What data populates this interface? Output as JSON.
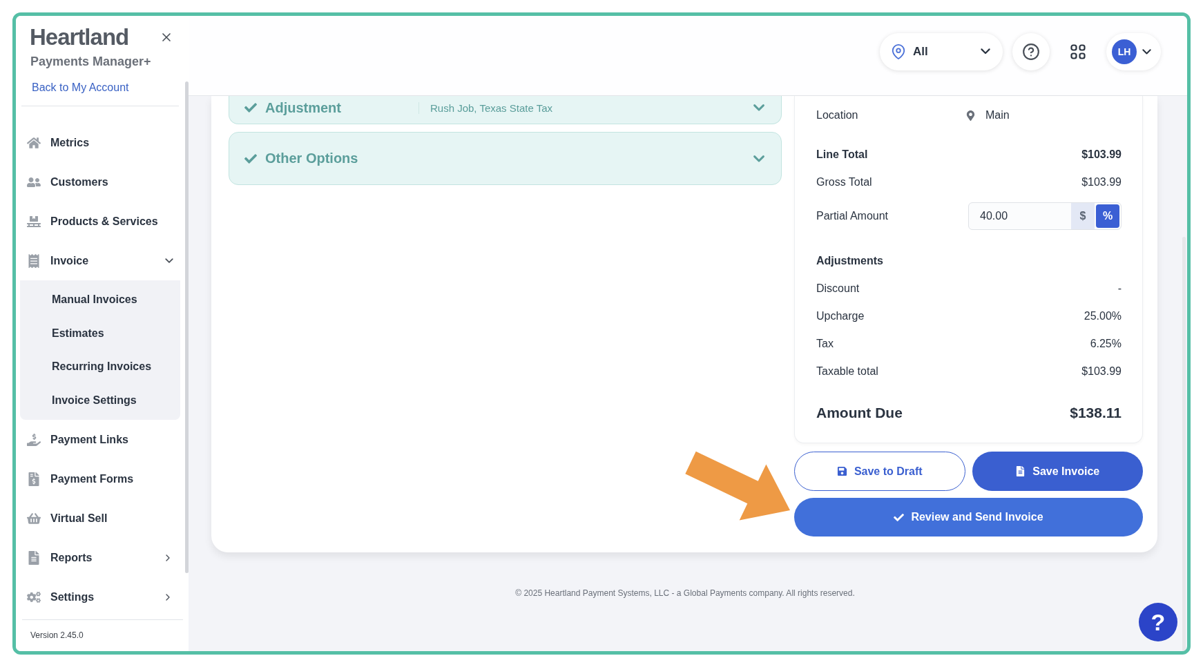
{
  "sidebar": {
    "brand": "Heartland",
    "product": "Payments Manager+",
    "back_link": "Back to My Account",
    "nav": [
      {
        "label": "Metrics"
      },
      {
        "label": "Customers"
      },
      {
        "label": "Products & Services"
      },
      {
        "label": "Invoice",
        "expanded": true,
        "children": [
          {
            "label": "Manual Invoices"
          },
          {
            "label": "Estimates"
          },
          {
            "label": "Recurring Invoices"
          },
          {
            "label": "Invoice Settings"
          }
        ]
      },
      {
        "label": "Payment Links"
      },
      {
        "label": "Payment Forms"
      },
      {
        "label": "Virtual Sell"
      },
      {
        "label": "Reports",
        "expanded": false
      },
      {
        "label": "Settings",
        "expanded": false
      }
    ],
    "version": "Version 2.45.0"
  },
  "header": {
    "location_filter": "All",
    "avatar": "LH"
  },
  "accordions": [
    {
      "title": "Adjustment",
      "summary": "Rush Job, Texas State Tax"
    },
    {
      "title": "Other Options"
    }
  ],
  "summary": {
    "location": {
      "label": "Location",
      "value": "Main"
    },
    "line_total": {
      "label": "Line Total",
      "value": "$103.99"
    },
    "gross_total": {
      "label": "Gross Total",
      "value": "$103.99"
    },
    "partial_amount": {
      "label": "Partial Amount",
      "value": "40.00",
      "units": [
        {
          "label": "$",
          "selected": false
        },
        {
          "label": "%",
          "selected": true
        }
      ]
    },
    "adjustments": {
      "title": "Adjustments",
      "rows": [
        {
          "label": "Discount",
          "value": "-"
        },
        {
          "label": "Upcharge",
          "value": "25.00%"
        },
        {
          "label": "Tax",
          "value": "6.25%"
        },
        {
          "label": "Taxable total",
          "value": "$103.99"
        }
      ]
    },
    "amount_due": {
      "label": "Amount Due",
      "value": "$138.11"
    }
  },
  "buttons": [
    {
      "label": "Save to Draft",
      "kind": "outline"
    },
    {
      "label": "Save Invoice",
      "kind": "primary"
    },
    {
      "label": "Review and Send Invoice",
      "kind": "send"
    }
  ],
  "footer": "© 2025 Heartland Payment Systems, LLC - a Global Payments company. All rights reserved.",
  "help_button": "?"
}
